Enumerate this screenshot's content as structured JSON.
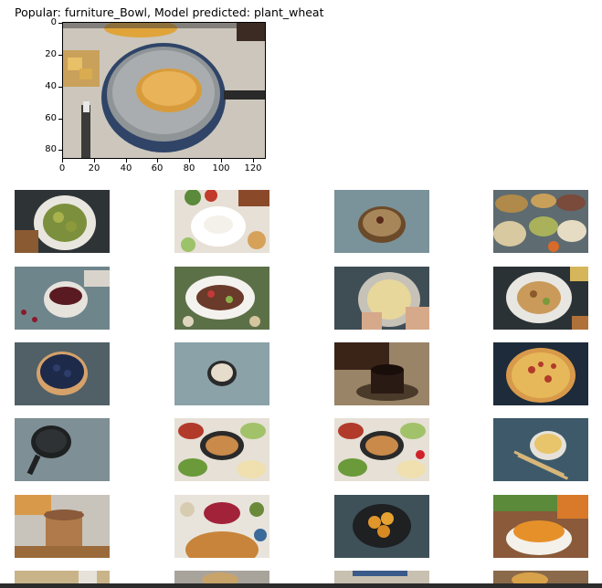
{
  "title": "Popular: furniture_Bowl, Model predicted: plant_wheat",
  "axes": {
    "y_ticks": [
      "0",
      "20",
      "40",
      "60",
      "80"
    ],
    "x_ticks": [
      "0",
      "20",
      "40",
      "60",
      "80",
      "100",
      "120"
    ]
  },
  "main_image": {
    "icon": "frying-pan-pancake-image"
  },
  "gallery": [
    {
      "name": "sprouts-plate-image"
    },
    {
      "name": "rice-bowl-image"
    },
    {
      "name": "grain-bowl-image"
    },
    {
      "name": "spice-bowls-image"
    },
    {
      "name": "berry-jam-bowl-image"
    },
    {
      "name": "meat-salad-plate-image"
    },
    {
      "name": "couscous-plate-image"
    },
    {
      "name": "pasta-plate-image"
    },
    {
      "name": "blueberry-bowl-image"
    },
    {
      "name": "white-beans-bowl-image"
    },
    {
      "name": "coffee-cup-image"
    },
    {
      "name": "pizza-image"
    },
    {
      "name": "cast-iron-pan-image"
    },
    {
      "name": "food-spread-image"
    },
    {
      "name": "food-spread-2-image"
    },
    {
      "name": "noodles-bowl-image"
    },
    {
      "name": "toast-jar-image"
    },
    {
      "name": "jam-spread-image"
    },
    {
      "name": "nuggets-plate-image"
    },
    {
      "name": "soup-bowl-image"
    },
    {
      "name": "partial-image-1"
    },
    {
      "name": "partial-image-2"
    },
    {
      "name": "partial-image-3"
    },
    {
      "name": "partial-image-4"
    }
  ]
}
